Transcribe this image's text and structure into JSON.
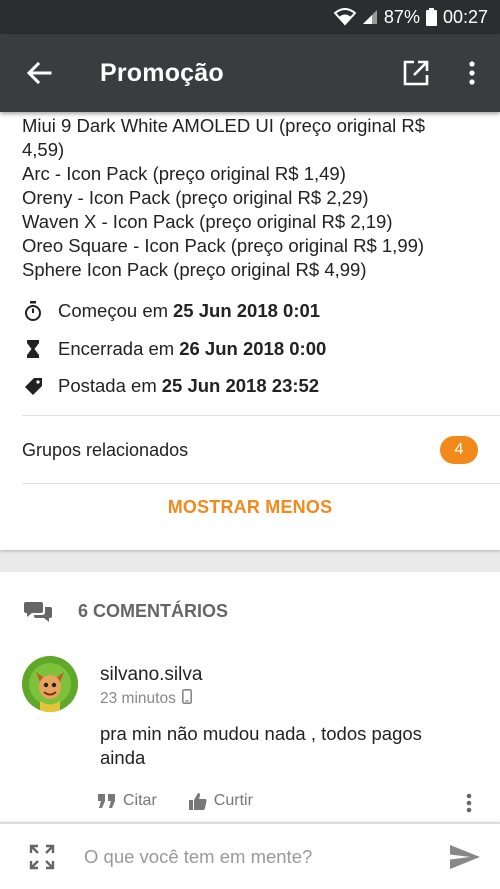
{
  "status_bar": {
    "battery": "87%",
    "time": "00:27"
  },
  "app_bar": {
    "title": "Promoção"
  },
  "deal": {
    "description_lines": [
      "Miui 9 Dark White AMOLED UI (preço original R$",
      "4,59)",
      "Arc - Icon Pack (preço original R$ 1,49)",
      "Oreny - Icon Pack (preço original R$ 2,29)",
      "Waven X - Icon Pack (preço original R$ 2,19)",
      "Oreo Square - Icon Pack (preço original R$ 1,99)",
      "Sphere Icon Pack (preço original R$ 4,99)"
    ],
    "started_label": "Começou em",
    "started_value": "25 Jun 2018 0:01",
    "ended_label": "Encerrada em",
    "ended_value": "26 Jun 2018 0:00",
    "posted_label": "Postada em",
    "posted_value": "25 Jun 2018 23:52",
    "related_groups_label": "Grupos relacionados",
    "related_groups_count": "4",
    "show_less_label": "MOSTRAR MENOS"
  },
  "comments": {
    "header": "6 COMENTÁRIOS",
    "items": [
      {
        "user": "silvano.silva",
        "time": "23 minutos",
        "text": "pra min não mudou nada , todos pagos ainda",
        "quote_label": "Citar",
        "like_label": "Curtir"
      }
    ]
  },
  "composer": {
    "placeholder": "O que você tem em mente?"
  },
  "colors": {
    "accent": "#f28a1b",
    "app_bar": "#3a3c3f",
    "status_bar": "#2b2d30"
  }
}
